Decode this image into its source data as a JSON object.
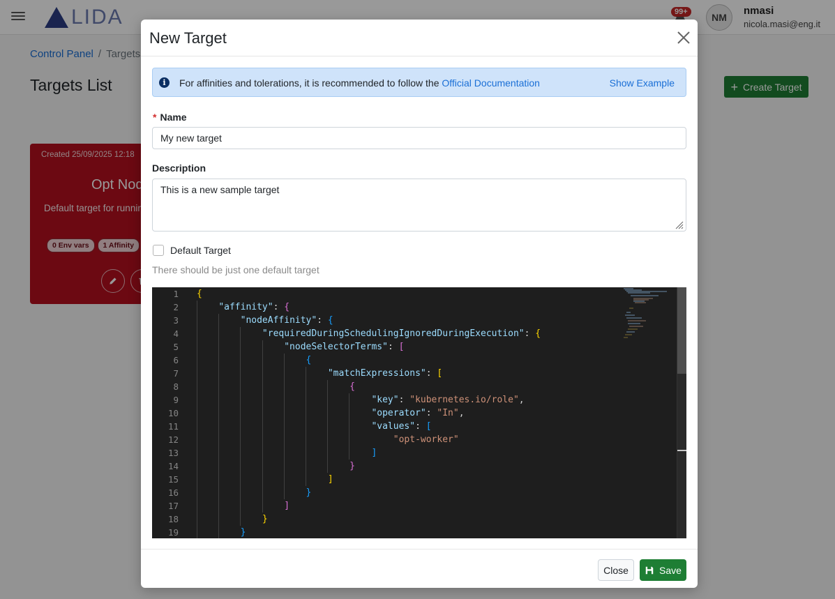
{
  "app": {
    "notifications_count": "99+",
    "avatar_initials": "NM",
    "user_name": "nmasi",
    "user_email": "nicola.masi@eng.it",
    "logo_text": "LIDA",
    "breadcrumb": {
      "root": "Control Panel",
      "separator": "/",
      "current": "Targets"
    },
    "page_title": "Targets List",
    "create_button": "Create Target",
    "card": {
      "created": "Created 25/09/2025 12:18",
      "title": "Opt Node",
      "description": "Default target for running",
      "pills": [
        "0 Env vars",
        "1 Affinity"
      ]
    }
  },
  "modal": {
    "title": "New Target",
    "alert": {
      "text": "For affinities and tolerations, it is recommended to follow the ",
      "link": "Official Documentation",
      "show_example": "Show Example"
    },
    "name": {
      "required_mark": "*",
      "label": "Name",
      "value": "My new target"
    },
    "description": {
      "label": "Description",
      "value": "This is a new sample target"
    },
    "default_checkbox_label": "Default Target",
    "hint": "There should be just one default target",
    "code_lines": [
      "{",
      "    \"affinity\": {",
      "        \"nodeAffinity\": {",
      "            \"requiredDuringSchedulingIgnoredDuringExecution\": {",
      "                \"nodeSelectorTerms\": [",
      "                    {",
      "                        \"matchExpressions\": [",
      "                            {",
      "                                \"key\": \"kubernetes.io/role\",",
      "                                \"operator\": \"In\",",
      "                                \"values\": [",
      "                                    \"opt-worker\"",
      "                                ]",
      "                            }",
      "                        ]",
      "                    }",
      "                ]",
      "            }",
      "        }"
    ],
    "close_button": "Close",
    "save_button": "Save"
  },
  "colors": {
    "accent_green": "#1e7e34",
    "card_red": "#b4101f",
    "link_blue": "#1a6fd6",
    "alert_bg": "#cfe3fa"
  },
  "icons": {
    "menu": "hamburger-icon",
    "notifications": "bell-icon",
    "close": "close-icon",
    "info": "info-icon",
    "plus": "plus-icon",
    "save": "floppy-disk-icon",
    "edit": "pencil-icon",
    "delete": "trash-icon"
  }
}
